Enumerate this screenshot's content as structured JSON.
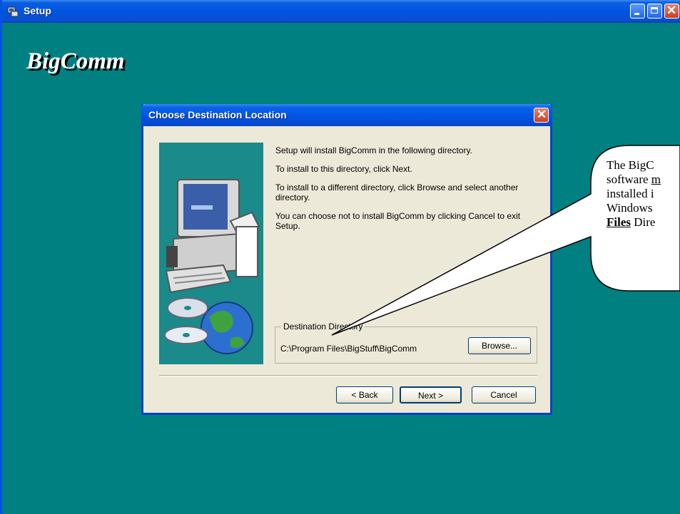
{
  "outer_window": {
    "title": "Setup",
    "brand": "BigComm",
    "colors": {
      "desktop_bg": "#008080",
      "titlebar": "#0054e3"
    }
  },
  "dialog": {
    "title": "Choose Destination Location",
    "messages": [
      "Setup will install BigComm in the following directory.",
      "To install to this directory, click Next.",
      "To install to a different directory, click Browse and select another directory.",
      "You can choose not to install BigComm by clicking Cancel to exit Setup."
    ],
    "destination": {
      "label": "Destination Directory",
      "path": "C:\\Program Files\\BigStuff\\BigComm",
      "browse_label": "Browse..."
    },
    "buttons": {
      "back": "< Back",
      "next": "Next >",
      "cancel": "Cancel"
    }
  },
  "callout": {
    "line1": "The BigC",
    "line2_pre": "software ",
    "line2_emph": "m",
    "line3": "installed i",
    "line4": "Windows",
    "line5_emph": "Files",
    "line5_post": " Dire"
  }
}
